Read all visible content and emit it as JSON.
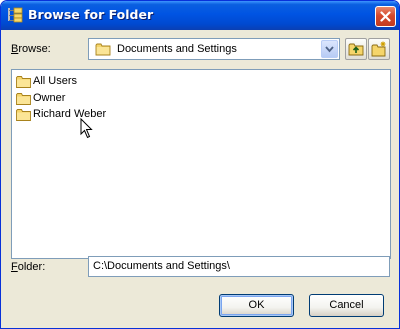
{
  "window": {
    "title": "Browse for Folder",
    "title_icon": "folder-tree-icon",
    "close_icon": "close-icon"
  },
  "browse": {
    "label": "Browse:",
    "accel": "B",
    "label_rest": "rowse:",
    "selected": "Documents and Settings",
    "up_icon": "up-one-level-icon",
    "new_folder_icon": "new-folder-icon"
  },
  "tree": {
    "items": [
      {
        "label": "All Users",
        "icon": "folder-icon"
      },
      {
        "label": "Owner",
        "icon": "folder-icon"
      },
      {
        "label": "Richard Weber",
        "icon": "folder-icon"
      }
    ]
  },
  "folder": {
    "label": "Folder:",
    "accel": "F",
    "label_rest": "older:",
    "value": "C:\\Documents and Settings\\"
  },
  "buttons": {
    "ok": "OK",
    "cancel": "Cancel"
  },
  "colors": {
    "titlebar": "#0054e3",
    "dialog_bg": "#ece9d8",
    "border": "#7f9db9",
    "close": "#d6492d"
  }
}
